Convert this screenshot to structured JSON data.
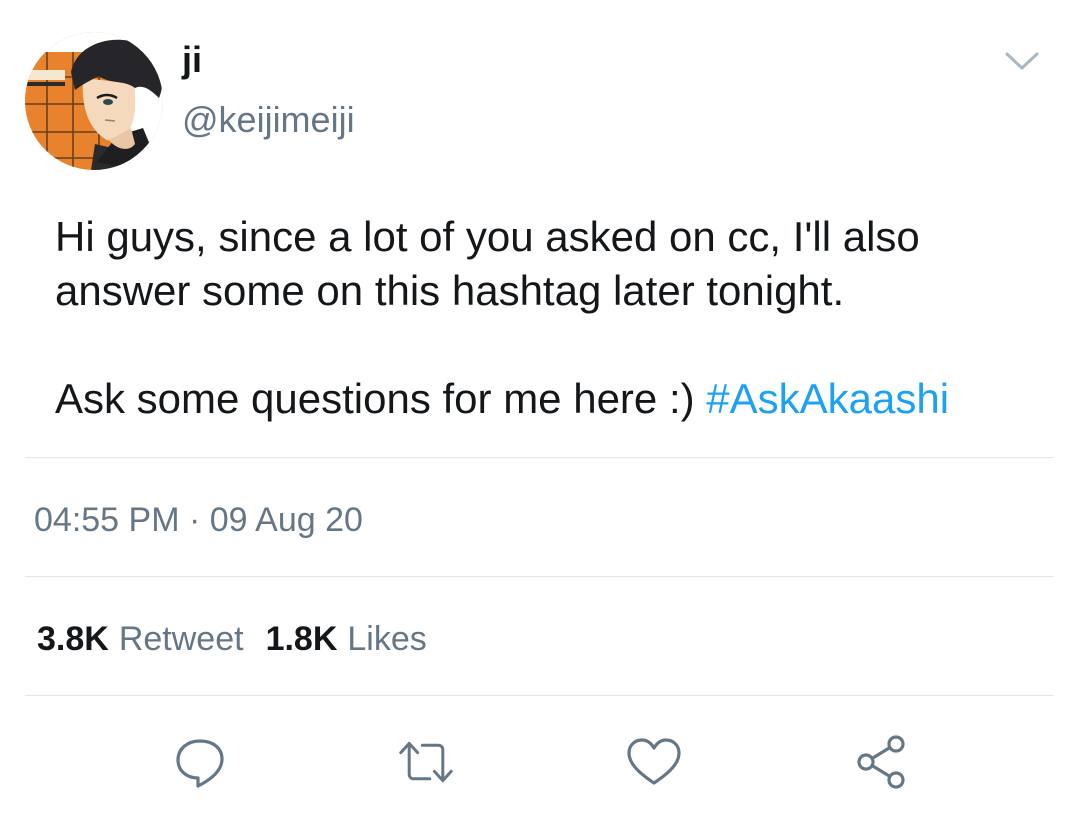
{
  "author": {
    "display_name": "ji",
    "handle": "@keijimeiji",
    "avatar_icon": "anime-avatar"
  },
  "tweet": {
    "line1": "Hi guys, since a lot of you asked on cc, I'll also",
    "line2": "answer some on this hashtag later tonight.",
    "line3_text": "Ask some questions for me here :) ",
    "hashtag": "#AskAkaashi",
    "time": "04:55 PM",
    "separator": " · ",
    "date": "09 Aug 20"
  },
  "stats": {
    "retweets_count": "3.8K",
    "retweets_label": "Retweet",
    "likes_count": "1.8K",
    "likes_label": "Likes"
  },
  "actions": {
    "reply_icon": "reply-icon",
    "retweet_icon": "retweet-icon",
    "like_icon": "heart-icon",
    "share_icon": "share-icon",
    "menu_icon": "chevron-down-icon"
  },
  "colors": {
    "text": "#14171a",
    "secondary": "#657786",
    "hashtag": "#1da1f2",
    "divider": "#e1e8ed",
    "icon": "#657786"
  }
}
